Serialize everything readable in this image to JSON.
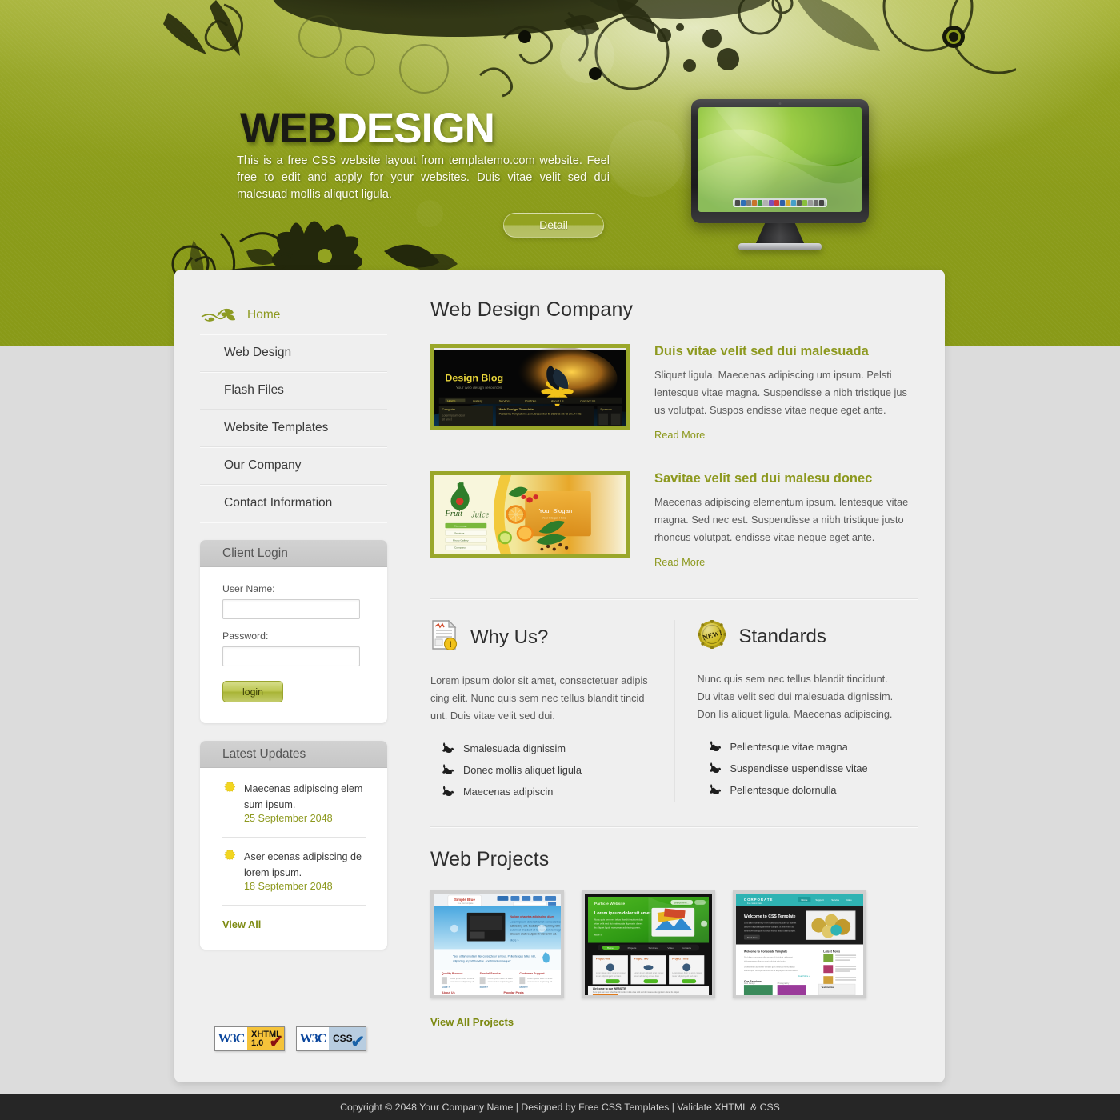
{
  "hero": {
    "title_part1": "WEB",
    "title_part2": "DESIGN",
    "description": "This is a free CSS website layout from templatemo.com website. Feel free to edit and apply for your websites. Duis vitae velit sed dui malesuad mollis aliquet ligula.",
    "detail_button": "Detail",
    "monitor_alt": "monitor-illustration"
  },
  "sidebar": {
    "nav": [
      {
        "label": "Home",
        "active": true
      },
      {
        "label": "Web Design",
        "active": false
      },
      {
        "label": "Flash Files",
        "active": false
      },
      {
        "label": "Website Templates",
        "active": false
      },
      {
        "label": "Our Company",
        "active": false
      },
      {
        "label": "Contact Information",
        "active": false
      }
    ],
    "login": {
      "title": "Client Login",
      "username_label": "User Name:",
      "username_value": "",
      "username_placeholder": "",
      "password_label": "Password:",
      "password_value": "",
      "password_placeholder": "",
      "submit_label": "login"
    },
    "updates": {
      "title": "Latest Updates",
      "items": [
        {
          "text": "Maecenas adipiscing elem sum ipsum.",
          "date": "25 September 2048"
        },
        {
          "text": "Aser ecenas adipiscing de lorem ipsum.",
          "date": "18 September 2048"
        }
      ],
      "view_all": "View All"
    },
    "badges": [
      {
        "brand": "W3C",
        "label": "XHTML 1.0",
        "type": "xhtml"
      },
      {
        "brand": "W3C",
        "label": "CSS",
        "type": "css"
      }
    ]
  },
  "content": {
    "page_title": "Web Design Company",
    "articles": [
      {
        "thumb_name": "design-blog-screenshot",
        "thumb_caption": "Design Blog",
        "thumb_sub": "Your web design resources",
        "title": "Duis vitae velit sed dui malesuada",
        "text": "Sliquet ligula. Maecenas adipiscing um ipsum. Pelsti lentesque vitae magna. Suspendisse a nibh tristique jus us volutpat. Suspos endisse vitae neque eget ante.",
        "read_more": "Read More"
      },
      {
        "thumb_name": "fruit-juice-screenshot",
        "thumb_caption": "Fruit Juice",
        "thumb_sub": "Your Slogan",
        "title": "Savitae velit sed dui malesu donec",
        "text": "Maecenas adipiscing elementum ipsum. lentesque vitae magna. Sed nec est. Suspendisse a nibh tristique justo rhoncus volutpat. endisse vitae neque eget ante.",
        "read_more": "Read More"
      }
    ],
    "columns": [
      {
        "icon": "document-alert-icon",
        "heading": "Why Us?",
        "text": "Lorem ipsum dolor sit amet, consectetuer adipis cing elit. Nunc quis sem nec tellus blandit tincid unt. Duis vitae velit sed dui.",
        "items": [
          "Smalesuada dignissim",
          "Donec mollis aliquet ligula",
          "Maecenas adipiscin"
        ]
      },
      {
        "icon": "new-badge-icon",
        "heading": "Standards",
        "text": "Nunc quis sem nec tellus blandit tincidunt. Du vitae velit sed dui malesuada dignissim. Don lis aliquet ligula. Maecenas adipiscing.",
        "items": [
          "Pellentesque vitae magna",
          "Suspendisse uspendisse vitae",
          "Pellentesque dolornulla"
        ]
      }
    ],
    "projects_title": "Web Projects",
    "projects": [
      {
        "name": "simple-blue-template",
        "label": "Simple Blue"
      },
      {
        "name": "particle-website-template",
        "label": "Particle Website"
      },
      {
        "name": "corporate-css-template",
        "label": "CORPORATE"
      }
    ],
    "view_all_projects": "View All Projects"
  },
  "footer": {
    "text": "Copyright © 2048 Your Company Name | Designed by Free CSS Templates | Validate XHTML & CSS"
  },
  "colors": {
    "green": "#8b9c1a",
    "accent": "#8d991f",
    "panel": "#efefef",
    "page_bg": "#dcdcdc",
    "footer_bg": "#262626"
  }
}
